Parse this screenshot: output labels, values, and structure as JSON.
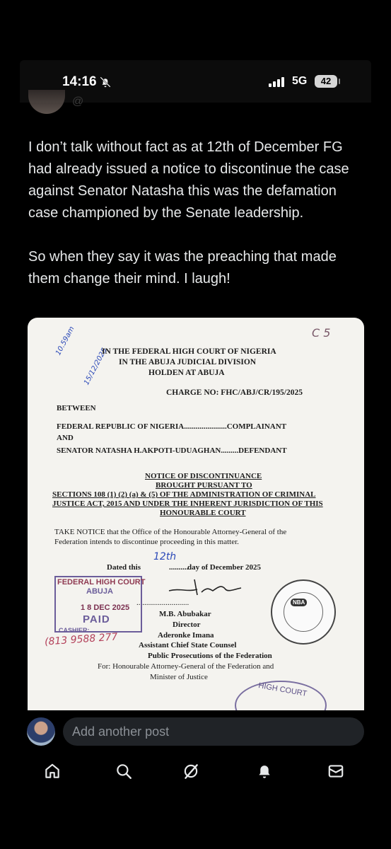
{
  "status_bar": {
    "time": "14:16",
    "network": "5G",
    "battery": "42"
  },
  "post": {
    "text": "I don’t talk without fact as at 12th of December FG had already issued a notice to discontinue the case against Senator Natasha this was the defamation case championed by the Senate leadership.\n\nSo when they say it was the preaching that made them change their mind. I laugh!"
  },
  "document": {
    "court_line_1": "IN THE FEDERAL HIGH COURT OF NIGERIA",
    "court_line_2": "IN THE ABUJA JUDICIAL DIVISION",
    "court_line_3": "HOLDEN AT ABUJA",
    "charge_no": "CHARGE NO: FHC/ABJ/CR/195/2025",
    "between": "BETWEEN",
    "party_1": "FEDERAL REPUBLIC OF NIGERIA......................COMPLAINANT",
    "and": "AND",
    "party_2": "SENATOR NATASHA H.AKPOTI-UDUAGHAN.........DEFENDANT",
    "notice_1": "NOTICE OF DISCONTINUANCE",
    "notice_2": "BROUGHT PURSUANT TO",
    "notice_3": "SECTIONS 108 (1) (2) (a) & (5) OF THE ADMINISTRATION OF CRIMINAL",
    "notice_4": "JUSTICE ACT, 2015 AND UNDER THE INHERENT JURISDICTION OF THIS",
    "notice_5": "HONOURABLE COURT",
    "take_notice_1": "TAKE NOTICE that the Office of the Honourable Attorney-General of the",
    "take_notice_2": "Federation intends to discontinue proceeding in this matter.",
    "dated_prefix": "Dated this",
    "dated_dots": "..........",
    "dated_suffix": "day of December 2025",
    "signature_dots": "...........................",
    "signer_1": "M.B. Abubakar",
    "signer_1_title": "Director",
    "signer_2": "Aderonke Imana",
    "signer_2_title": "Assistant Chief State Counsel",
    "signer_dept": "Public Prosecutions of the Federation",
    "signer_for": "For: Honourable Attorney-General of the Federation and",
    "signer_ministry": "Minister of Justice",
    "hand_ref": "C 5",
    "hand_date_1": "10.59am",
    "hand_date_2": "15/12/2025",
    "hand_day": "12th",
    "hand_phone": "(813 9588 277",
    "stamp_court": "FEDERAL HIGH COURT",
    "stamp_city": "ABUJA",
    "stamp_date": "1 8 DEC 2025",
    "stamp_status": "PAID",
    "stamp_cashier": "CASHIER:",
    "seal_label": "NBA",
    "seal_bottom": "HIGH COURT"
  },
  "composer": {
    "placeholder": "Add another post"
  },
  "tabs": [
    "home-icon",
    "search-icon",
    "grok-icon",
    "notifications-icon",
    "messages-icon"
  ]
}
